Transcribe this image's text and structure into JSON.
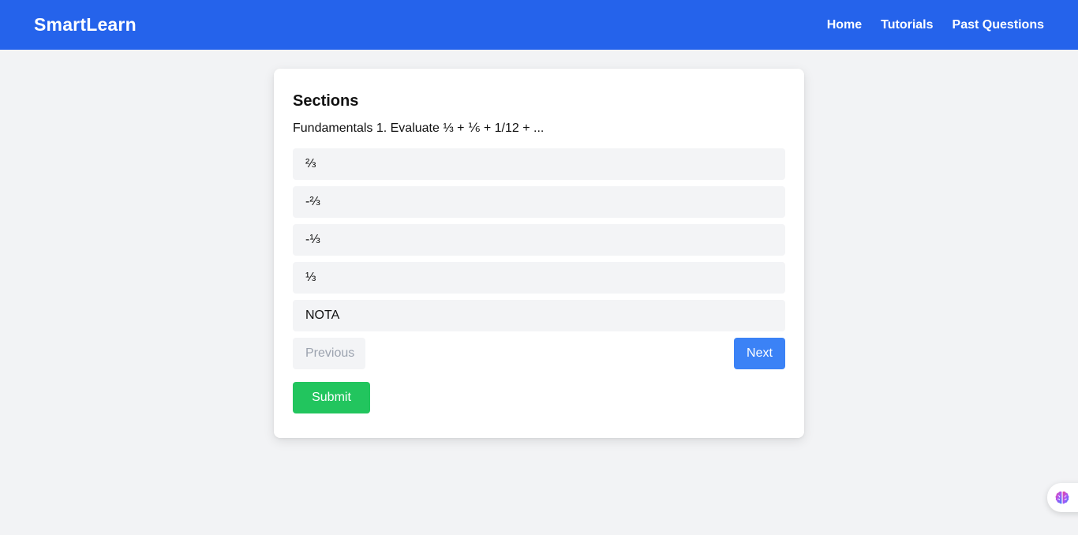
{
  "header": {
    "brand": "SmartLearn",
    "nav": [
      "Home",
      "Tutorials",
      "Past Questions"
    ]
  },
  "quiz": {
    "section_title": "Sections",
    "question": "Fundamentals 1. Evaluate ⅓ + ⅙ + 1/12 + ...",
    "options": [
      "⅔",
      "-⅔",
      "-⅓",
      "⅓",
      "NOTA"
    ],
    "previous_label": "Previous",
    "next_label": "Next",
    "submit_label": "Submit"
  },
  "colors": {
    "header_bg": "#2563eb",
    "next_button": "#3b82f6",
    "submit_button": "#22c55e",
    "page_bg": "#f2f3f5"
  },
  "icons": {
    "floating_helper": "brain-icon"
  }
}
